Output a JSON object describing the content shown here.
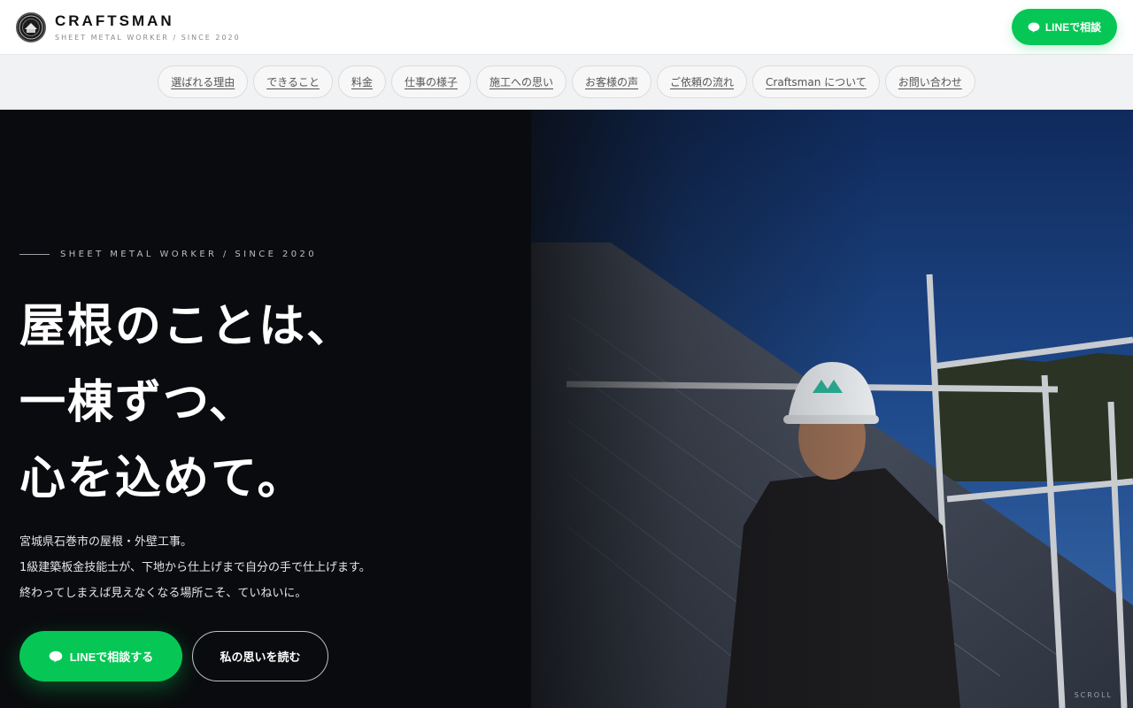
{
  "header": {
    "brand_name": "CRAFTSMAN",
    "brand_sub": "SHEET METAL WORKER / SINCE 2020",
    "line_button": "LINEで相談"
  },
  "nav": {
    "items": [
      {
        "label": "選ばれる理由"
      },
      {
        "label": "できること"
      },
      {
        "label": "料金"
      },
      {
        "label": "仕事の様子"
      },
      {
        "label": "施工への思い"
      },
      {
        "label": "お客様の声"
      },
      {
        "label": "ご依頼の流れ"
      },
      {
        "label": "Craftsman について"
      },
      {
        "label": "お問い合わせ"
      }
    ]
  },
  "hero": {
    "eyebrow": "SHEET METAL WORKER / SINCE 2020",
    "headline": [
      "屋根のことは、",
      "一棟ずつ、",
      "心を込めて。"
    ],
    "lead": [
      "宮城県石巻市の屋根・外壁工事。",
      "1級建築板金技能士が、下地から仕上げまで自分の手で仕上げます。",
      "終わってしまえば見えなくなる場所こそ、ていねいに。"
    ],
    "cta_line": "LINEで相談する",
    "cta_story": "私の思いを読む",
    "scroll": "SCROLL"
  },
  "icons": {
    "line_bubble": "chat-bubble-icon",
    "logo": "craftsman-logo"
  },
  "colors": {
    "line_green": "#06c755",
    "hero_dark": "#0a0c0f",
    "sky_blue": "#1f4a8c",
    "nav_bg": "#f1f2f3"
  }
}
